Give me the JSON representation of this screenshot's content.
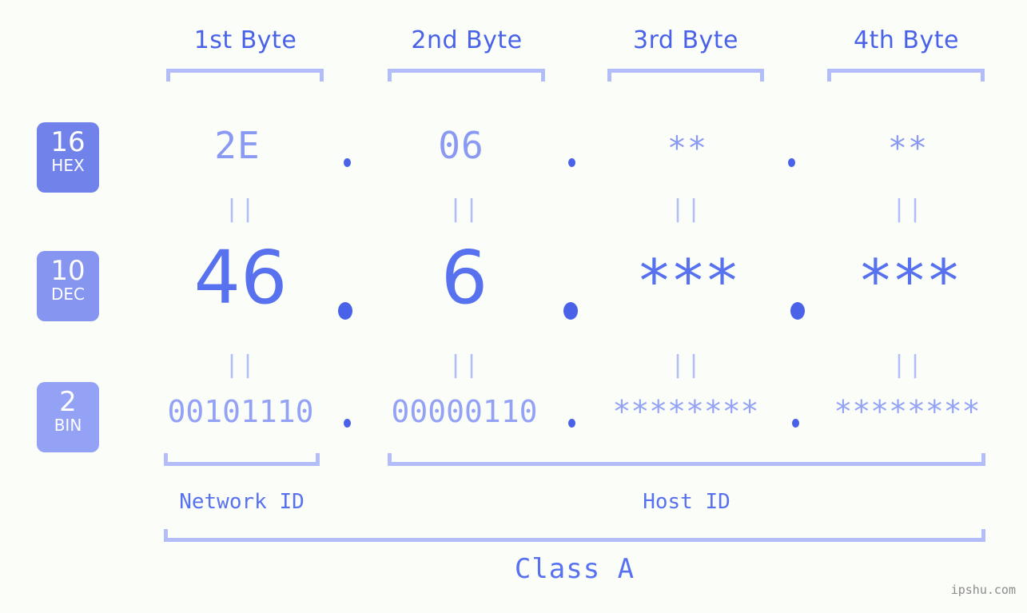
{
  "background_color": "#fbfdf8",
  "accent_colors": {
    "header_text": "#4a62e8",
    "bracket": "#b3bdfa",
    "badge_hex": "#7182ea",
    "badge_dec": "#8695ef",
    "badge_bin": "#93a2f5",
    "hex_value": "#8a99f2",
    "dec_value": "#5871ef",
    "bin_value": "#93a2f5",
    "dot": "#4a62e8",
    "watermark": "#8b8b8b"
  },
  "byte_headers": [
    {
      "label": "1st Byte"
    },
    {
      "label": "2nd Byte"
    },
    {
      "label": "3rd Byte"
    },
    {
      "label": "4th Byte"
    }
  ],
  "rows": [
    {
      "badge_number": "16",
      "badge_system": "HEX",
      "values": [
        "2E",
        "06",
        "**",
        "**"
      ]
    },
    {
      "badge_number": "10",
      "badge_system": "DEC",
      "values": [
        "46",
        "6",
        "***",
        "***"
      ]
    },
    {
      "badge_number": "2",
      "badge_system": "BIN",
      "values": [
        "00101110",
        "00000110",
        "********",
        "********"
      ]
    }
  ],
  "separators": {
    "dot": ".",
    "equals": "||"
  },
  "id_labels": [
    {
      "name": "Network ID"
    },
    {
      "name": "Host ID"
    }
  ],
  "class_label": "Class A",
  "watermark": "ipshu.com"
}
